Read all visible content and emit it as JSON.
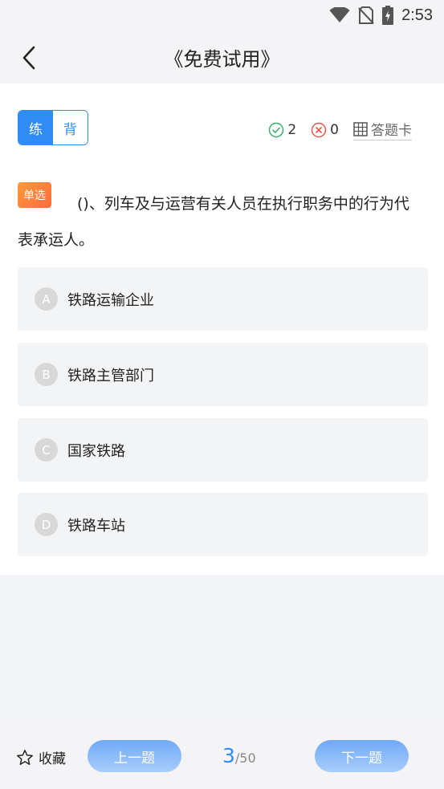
{
  "status": {
    "time": "2:53"
  },
  "header": {
    "title": "《免费试用》"
  },
  "mode": {
    "practice": "练",
    "memorize": "背"
  },
  "stats": {
    "correct": "2",
    "wrong": "0",
    "answer_card": "答题卡"
  },
  "question": {
    "type": "单选",
    "text": "()、列车及与运营有关人员在执行职务中的行为代表承运人。",
    "options": [
      {
        "letter": "A",
        "text": "铁路运输企业"
      },
      {
        "letter": "B",
        "text": "铁路主管部门"
      },
      {
        "letter": "C",
        "text": "国家铁路"
      },
      {
        "letter": "D",
        "text": "铁路车站"
      }
    ]
  },
  "footer": {
    "favorite": "收藏",
    "prev": "上一题",
    "next": "下一题",
    "current": "3",
    "total": "/50"
  },
  "colors": {
    "accent": "#2f8cf4",
    "badge": "#ff7a3d"
  }
}
